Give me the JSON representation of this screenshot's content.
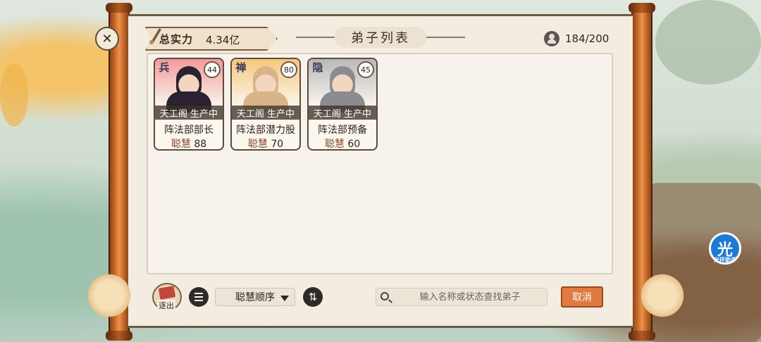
{
  "header": {
    "power_label": "总实力",
    "power_value": "4.34亿",
    "title": "弟子列表",
    "disciple_count": "184/200"
  },
  "disciples": [
    {
      "tag": "兵",
      "level": "44",
      "status": "天工阁 生产中",
      "department": "阵法部部长",
      "stat_name": "聪慧",
      "stat_value": "88",
      "portrait_color": "#f39a9a",
      "hair_color": "#2a2230"
    },
    {
      "tag": "禅",
      "level": "80",
      "status": "天工阁 生产中",
      "department": "阵法部潜力股",
      "stat_name": "聪慧",
      "stat_value": "70",
      "portrait_color": "#f6c77a",
      "hair_color": "#d9b48a"
    },
    {
      "tag": "隐",
      "level": "45",
      "status": "天工阁 生产中",
      "department": "阵法部预备",
      "stat_name": "聪慧",
      "stat_value": "60",
      "portrait_color": "#b9b9b9",
      "hair_color": "#8a8a90"
    }
  ],
  "toolbar": {
    "expel_label": "逐出",
    "sort_selected": "聪慧顺序",
    "search_placeholder": "输入名称或状态查找弟子",
    "cancel_label": "取消"
  },
  "side": {
    "helper_glyph": "光",
    "helper_label": "光环助手"
  },
  "colors": {
    "paper": "#f3ece0",
    "roller": "#c9692a",
    "cancel": "#e07a3e"
  }
}
